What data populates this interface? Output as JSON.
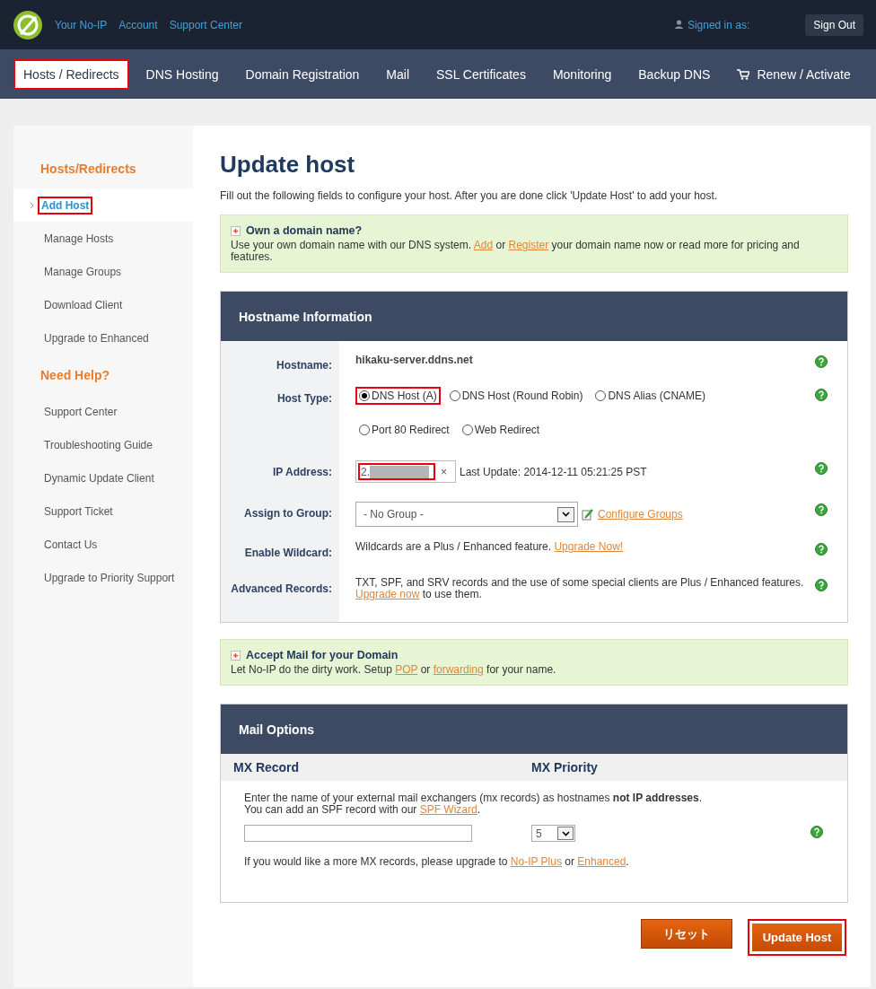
{
  "top_bar": {
    "links": [
      "Your No-IP",
      "Account",
      "Support Center"
    ],
    "signed_in": "Signed in as:",
    "sign_out": "Sign Out"
  },
  "nav": [
    {
      "label": "Hosts / Redirects",
      "selected": true,
      "highlighted": true,
      "kind": "page"
    },
    {
      "label": "DNS Hosting",
      "selected": false,
      "highlighted": false,
      "kind": "page"
    },
    {
      "label": "Domain Registration",
      "selected": false,
      "highlighted": false,
      "kind": "page"
    },
    {
      "label": "Mail",
      "selected": false,
      "highlighted": false,
      "kind": "page"
    },
    {
      "label": "SSL Certificates",
      "selected": false,
      "highlighted": false,
      "kind": "page"
    },
    {
      "label": "Monitoring",
      "selected": false,
      "highlighted": false,
      "kind": "page"
    },
    {
      "label": "Backup DNS",
      "selected": false,
      "highlighted": false,
      "kind": "page"
    },
    {
      "label": "Renew / Activate",
      "selected": false,
      "highlighted": false,
      "kind": "store"
    }
  ],
  "sidebar": [
    {
      "heading": "Hosts/Redirects",
      "items": [
        {
          "label": "Add Host",
          "selected": true,
          "highlighted": true
        },
        {
          "label": "Manage Hosts",
          "selected": false,
          "highlighted": false
        },
        {
          "label": "Manage Groups",
          "selected": false,
          "highlighted": false
        },
        {
          "label": "Download Client",
          "selected": false,
          "highlighted": false
        },
        {
          "label": "Upgrade to Enhanced",
          "selected": false,
          "highlighted": false
        }
      ]
    },
    {
      "heading": "Need Help?",
      "items": [
        {
          "label": "Support Center",
          "selected": false,
          "highlighted": false
        },
        {
          "label": "Troubleshooting Guide",
          "selected": false,
          "highlighted": false
        },
        {
          "label": "Dynamic Update Client",
          "selected": false,
          "highlighted": false
        },
        {
          "label": "Support Ticket",
          "selected": false,
          "highlighted": false
        },
        {
          "label": "Contact Us",
          "selected": false,
          "highlighted": false
        },
        {
          "label": "Upgrade to Priority Support",
          "selected": false,
          "highlighted": false
        }
      ]
    }
  ],
  "title": "Update host",
  "intro": "Fill out the following fields to configure your host. After you are done click 'Update Host' to add your host.",
  "domain_notice": {
    "title": "Own a domain name?",
    "body": [
      {
        "t": "Use your own domain name with our DNS system. "
      },
      {
        "link": "Add"
      },
      {
        "t": " or "
      },
      {
        "link": "Register"
      },
      {
        "t": " your domain name now or read more for pricing and features."
      }
    ]
  },
  "hostname_panel": {
    "title": "Hostname Information",
    "rows": [
      {
        "kind": "text",
        "label": "Hostname:",
        "value": "hikaku-server.ddns.net"
      },
      {
        "kind": "radios",
        "label": "Host Type:",
        "options": [
          {
            "label": "DNS Host (A)",
            "selected": true,
            "highlighted": true
          },
          {
            "label": "DNS Host (Round Robin)",
            "selected": false,
            "highlighted": false
          },
          {
            "label": "DNS Alias (CNAME)",
            "selected": false,
            "highlighted": false
          },
          {
            "label": "Port 80 Redirect",
            "selected": false,
            "highlighted": false
          },
          {
            "label": "Web Redirect",
            "selected": false,
            "highlighted": false
          }
        ]
      },
      {
        "kind": "ip",
        "label": "IP Address:",
        "value": "2.",
        "redacted": true,
        "highlighted": true,
        "clear": "×",
        "last_update": "Last Update: 2014-12-11 05:21:25 PST"
      },
      {
        "kind": "select",
        "label": "Assign to Group:",
        "value": "- No Group -",
        "link": "Configure Groups"
      },
      {
        "kind": "note",
        "label": "Enable Wildcard:",
        "body": [
          {
            "t": "Wildcards are a Plus / Enhanced feature. "
          },
          {
            "link": "Upgrade Now!"
          }
        ]
      },
      {
        "kind": "note",
        "label": "Advanced Records:",
        "body": [
          {
            "t": "TXT, SPF, and SRV records and the use of some special clients are Plus / Enhanced features. "
          },
          {
            "link": "Upgrade now"
          },
          {
            "t": " to use them."
          }
        ]
      }
    ]
  },
  "mail_notice": {
    "title": "Accept Mail for your Domain",
    "body": [
      {
        "t": "Let No-IP do the dirty work. Setup "
      },
      {
        "link": "POP"
      },
      {
        "t": " or "
      },
      {
        "link": "forwarding"
      },
      {
        "t": " for your name."
      }
    ]
  },
  "mail_panel": {
    "title": "Mail Options",
    "columns": [
      "MX Record",
      "MX Priority"
    ],
    "instructions": [
      {
        "t": "Enter the name of your external mail exchangers (mx records) as hostnames **not IP addresses**."
      }
    ],
    "spf": [
      {
        "t": "You can add an SPF record with our "
      },
      {
        "link": "SPF Wizard"
      },
      {
        "t": "."
      }
    ],
    "priority": "5",
    "footer": [
      {
        "t": "If you would like a more MX records, please upgrade to "
      },
      {
        "link": "No-IP Plus"
      },
      {
        "t": " or "
      },
      {
        "link": "Enhanced"
      },
      {
        "t": "."
      }
    ]
  },
  "buttons": [
    {
      "label": "リセット",
      "kind": "secondary",
      "highlighted": false
    },
    {
      "label": "Update Host",
      "kind": "primary",
      "highlighted": true
    }
  ]
}
